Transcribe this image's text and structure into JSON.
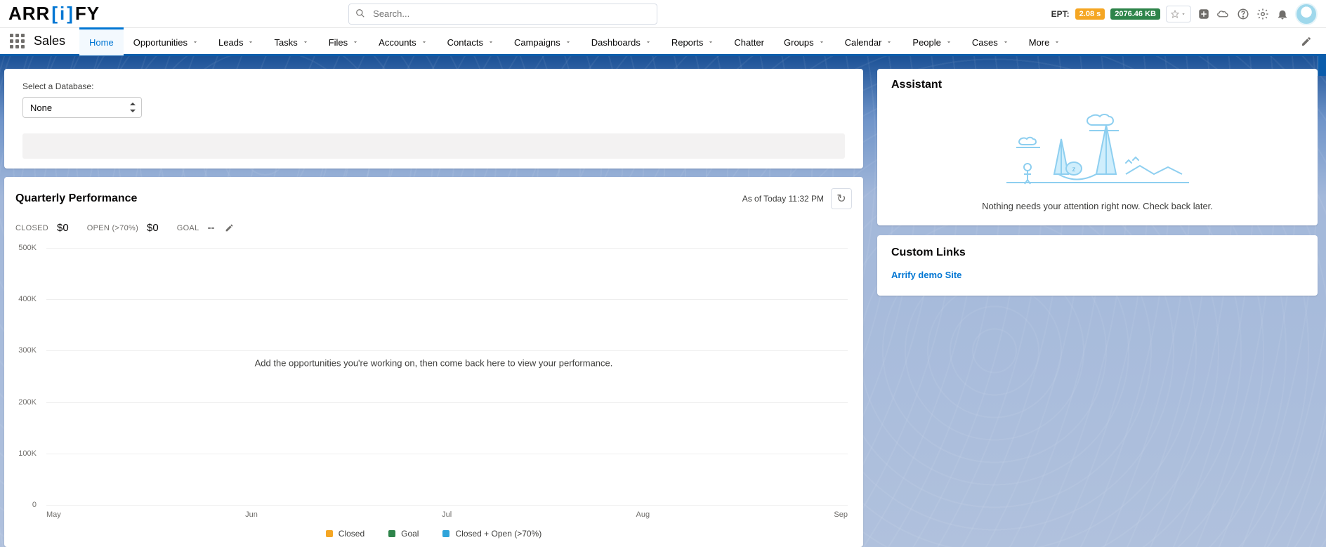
{
  "header": {
    "logo_parts": {
      "p1": "ARR",
      "bl": "[",
      "i": "i",
      "br": "]",
      "p2": "FY"
    },
    "search_placeholder": "Search...",
    "ept_label": "EPT:",
    "ept_time": "2.08 s",
    "ept_size": "2076.46 KB"
  },
  "nav": {
    "app_name": "Sales",
    "tabs": [
      "Home",
      "Opportunities",
      "Leads",
      "Tasks",
      "Files",
      "Accounts",
      "Contacts",
      "Campaigns",
      "Dashboards",
      "Reports",
      "Chatter",
      "Groups",
      "Calendar",
      "People",
      "Cases",
      "More"
    ],
    "active": "Home",
    "no_chevron": [
      "Home",
      "Chatter"
    ]
  },
  "db_card": {
    "label": "Select a Database:",
    "selected": "None"
  },
  "qp": {
    "title": "Quarterly Performance",
    "asof": "As of Today 11:32 PM",
    "closed_label": "CLOSED",
    "closed_val": "$0",
    "open_label": "OPEN (>70%)",
    "open_val": "$0",
    "goal_label": "GOAL",
    "goal_val": "--",
    "empty_msg": "Add the opportunities you're working on, then come back here to view your performance."
  },
  "assistant": {
    "title": "Assistant",
    "message": "Nothing needs your attention right now. Check back later."
  },
  "custom_links": {
    "title": "Custom Links",
    "links": [
      "Arrify demo Site"
    ]
  },
  "chart_data": {
    "type": "bar",
    "categories": [
      "May",
      "Jun",
      "Jul",
      "Aug",
      "Sep"
    ],
    "series": [
      {
        "name": "Closed",
        "color": "#f5a623",
        "values": [
          0,
          0,
          0,
          0,
          0
        ]
      },
      {
        "name": "Goal",
        "color": "#2e844a",
        "values": [
          0,
          0,
          0,
          0,
          0
        ]
      },
      {
        "name": "Closed + Open (>70%)",
        "color": "#2fa4da",
        "values": [
          0,
          0,
          0,
          0,
          0
        ]
      }
    ],
    "y_ticks": [
      "0",
      "100K",
      "200K",
      "300K",
      "400K",
      "500K"
    ],
    "ylim": [
      0,
      500000
    ],
    "legend_position": "bottom"
  }
}
